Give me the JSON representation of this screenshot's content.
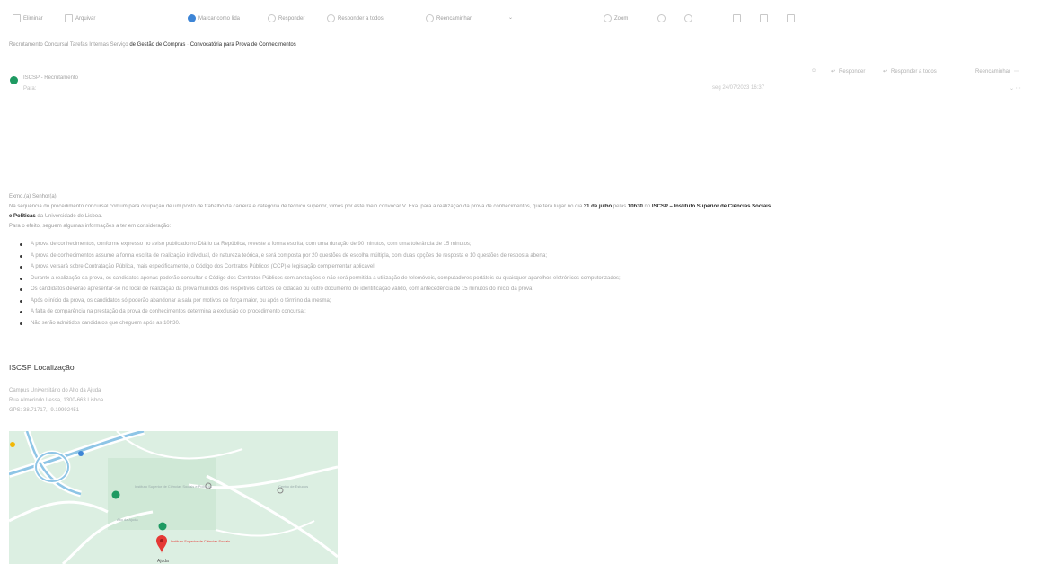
{
  "toolbar": {
    "delete": "Eliminar",
    "archive": "Arquivar",
    "mark_read": "Marcar como lida",
    "reply": "Responder",
    "reply_all": "Responder a todos",
    "forward": "Reencaminhar",
    "zoom": "Zoom"
  },
  "breadcrumb": {
    "part1": "Recrutamento Concursal Tarefas Internas",
    "part2": "Serviço",
    "part3": "de Gestão de Compras",
    "part4": "Convocatória para Prova de Conhecimentos"
  },
  "message": {
    "sender": "ISCSP - Recrutamento",
    "to": "Para:",
    "date": "seg 24/07/2023 16:37",
    "reply": "Responder",
    "reply_all": "Responder a todos",
    "forward": "Reencaminhar"
  },
  "body": {
    "greeting": "Exmo.(a) Senhor(a),",
    "para1_start": "Na sequência do procedimento concursal comum para ocupação de um posto de trabalho da carreira e categoria de técnico superior, vimos por este meio convocar V. Exa. para a realização da prova de conhecimentos, que terá lugar no dia",
    "date_bold": "31 de julho",
    "para1_mid": "pelas",
    "time_bold": "10h30",
    "para1_mid2": "no",
    "place_bold": "ISCSP – Instituto Superior de Ciências Sociais",
    "place_bold2": "e Políticas",
    "para1_end": "da Universidade de Lisboa.",
    "para2": "Para o efeito, seguem algumas informações a ter em consideração:",
    "items": [
      "A prova de conhecimentos, conforme expresso no aviso publicado no Diário da República, reveste a forma escrita, com uma duração de 90 minutos, com uma tolerância de 15 minutos;",
      "A prova de conhecimentos assume a forma escrita de realização individual, de natureza teórica, e será composta por 20 questões de escolha múltipla, com duas opções de resposta e 10 questões de resposta aberta;",
      "A prova versará sobre Contratação Pública, mais especificamente, o Código dos Contratos Públicos (CCP) e legislação complementar aplicável;",
      "Durante a realização da prova, os candidatos apenas poderão consultar o Código dos Contratos Públicos sem anotações e não será permitida a utilização de telemóveis, computadores portáteis ou quaisquer aparelhos eletrónicos computorizados;",
      "Os candidatos deverão apresentar-se no local de realização da prova munidos dos respetivos cartões de cidadão ou outro documento de identificação válido, com antecedência de 15 minutos do início da prova;",
      "Após o início da prova, os candidatos só poderão abandonar a sala por motivos de força maior, ou após o término da mesma;",
      "A falta de comparência na prestação da prova de conhecimentos determina a exclusão do procedimento concursal;",
      "Não serão admitidos candidatos que cheguem após as 10h30."
    ]
  },
  "location": {
    "title": "ISCSP Localização",
    "addr1": "Campus Universitário do Alto da Ajuda",
    "addr2": "Rua Almerindo Lessa, 1300-663 Lisboa",
    "addr3": "GPS: 38.71717, -9.19992451"
  },
  "map": {
    "label1": "Instituto Superior de Ciências Sociais e Políticas",
    "label2": "Centro de Estudos",
    "label3": "Alto da Ajuda",
    "label4": "Ajuda",
    "pin_label": "Instituto Superior de Ciências Sociais",
    "colors": {
      "land": "#dcefe2",
      "road": "#ffffff",
      "road_main": "#8ec5e6",
      "pin": "#e53935",
      "poi": "#1e9a62"
    }
  }
}
